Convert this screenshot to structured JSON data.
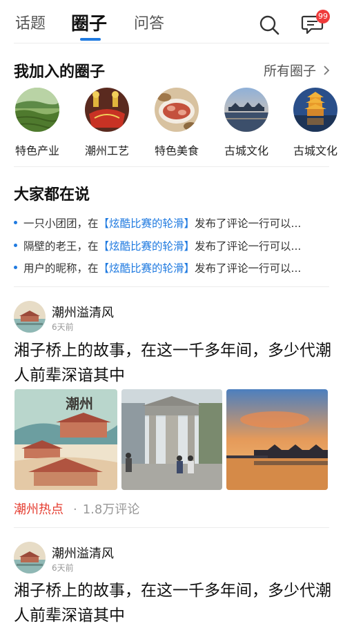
{
  "tabs": [
    {
      "label": "话题"
    },
    {
      "label": "圈子"
    },
    {
      "label": "问答"
    }
  ],
  "header": {
    "message_badge": "99"
  },
  "joined": {
    "title": "我加入的圈子",
    "all_link": "所有圈子",
    "circles": [
      {
        "label": "特色产业"
      },
      {
        "label": "潮州工艺"
      },
      {
        "label": "特色美食"
      },
      {
        "label": "古城文化"
      },
      {
        "label": "古城文化"
      }
    ]
  },
  "discussion": {
    "title": "大家都在说",
    "items": [
      {
        "user": "一只小团团，在",
        "topic": "【炫酷比赛的轮滑】",
        "action": "发布了评论一行可以..."
      },
      {
        "user": "隔壁的老王，在",
        "topic": "【炫酷比赛的轮滑】",
        "action": "发布了评论一行可以..."
      },
      {
        "user": "用户的昵称，在",
        "topic": "【炫酷比赛的轮滑】",
        "action": "发布了评论一行可以..."
      }
    ]
  },
  "posts": [
    {
      "author": "潮州溢清风",
      "time": "6天前",
      "title": "湘子桥上的故事，在这一千多年间，多少代潮人前辈深谙其中",
      "image_text": "潮州",
      "tag": "潮州热点",
      "separator": "·",
      "comments": "1.8万评论"
    },
    {
      "author": "潮州溢清风",
      "time": "6天前",
      "title": "湘子桥上的故事，在这一千多年间，多少代潮人前辈深谙其中"
    }
  ],
  "colors": {
    "accent": "#1f7ae0",
    "tag": "#e53d30",
    "badge": "#ef3b3b"
  }
}
